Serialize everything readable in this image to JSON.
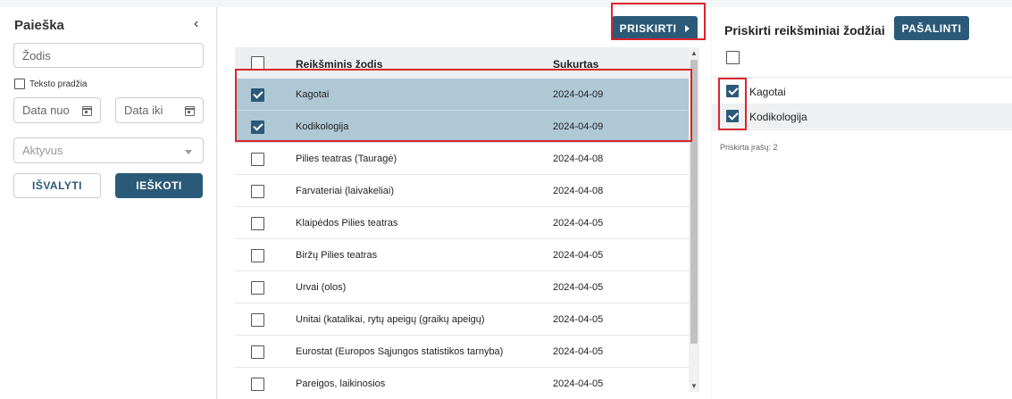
{
  "search_panel": {
    "title": "Paieška",
    "word_placeholder": "Žodis",
    "prefix_label": "Teksto pradžia",
    "date_from_placeholder": "Data nuo",
    "date_to_placeholder": "Data iki",
    "active_placeholder": "Aktyvus",
    "clear_label": "IŠVALYTI",
    "search_label": "IEŠKOTI"
  },
  "results": {
    "assign_label": "PRISKIRTI",
    "columns": [
      "Reikšminis žodis",
      "Sukurtas"
    ],
    "rows": [
      {
        "word": "Kagotai",
        "date": "2024-04-09",
        "checked": true
      },
      {
        "word": "Kodikologija",
        "date": "2024-04-09",
        "checked": true
      },
      {
        "word": "Pilies teatras (Tauragė)",
        "date": "2024-04-08",
        "checked": false
      },
      {
        "word": "Farvateriai (laivakeliai)",
        "date": "2024-04-08",
        "checked": false
      },
      {
        "word": "Klaipėdos Pilies teatras",
        "date": "2024-04-05",
        "checked": false
      },
      {
        "word": "Biržų Pilies teatras",
        "date": "2024-04-05",
        "checked": false
      },
      {
        "word": "Urvai (olos)",
        "date": "2024-04-05",
        "checked": false
      },
      {
        "word": "Unitai (katalikai, rytų apeigų (graikų apeigų)",
        "date": "2024-04-05",
        "checked": false
      },
      {
        "word": "Eurostat (Europos Sąjungos statistikos tarnyba)",
        "date": "2024-04-05",
        "checked": false
      },
      {
        "word": "Pareigos, laikinosios",
        "date": "2024-04-05",
        "checked": false
      }
    ]
  },
  "assigned": {
    "title": "Priskirti reikšminiai žodžiai",
    "remove_label": "PAŠALINTI",
    "items": [
      {
        "label": "Kagotai",
        "checked": true
      },
      {
        "label": "Kodikologija",
        "checked": true
      }
    ],
    "count_text": "Priskirta įrašų: 2"
  },
  "colors": {
    "primary": "#2b5a78",
    "selected_row": "#afc8d6",
    "highlight": "#d9262c"
  }
}
